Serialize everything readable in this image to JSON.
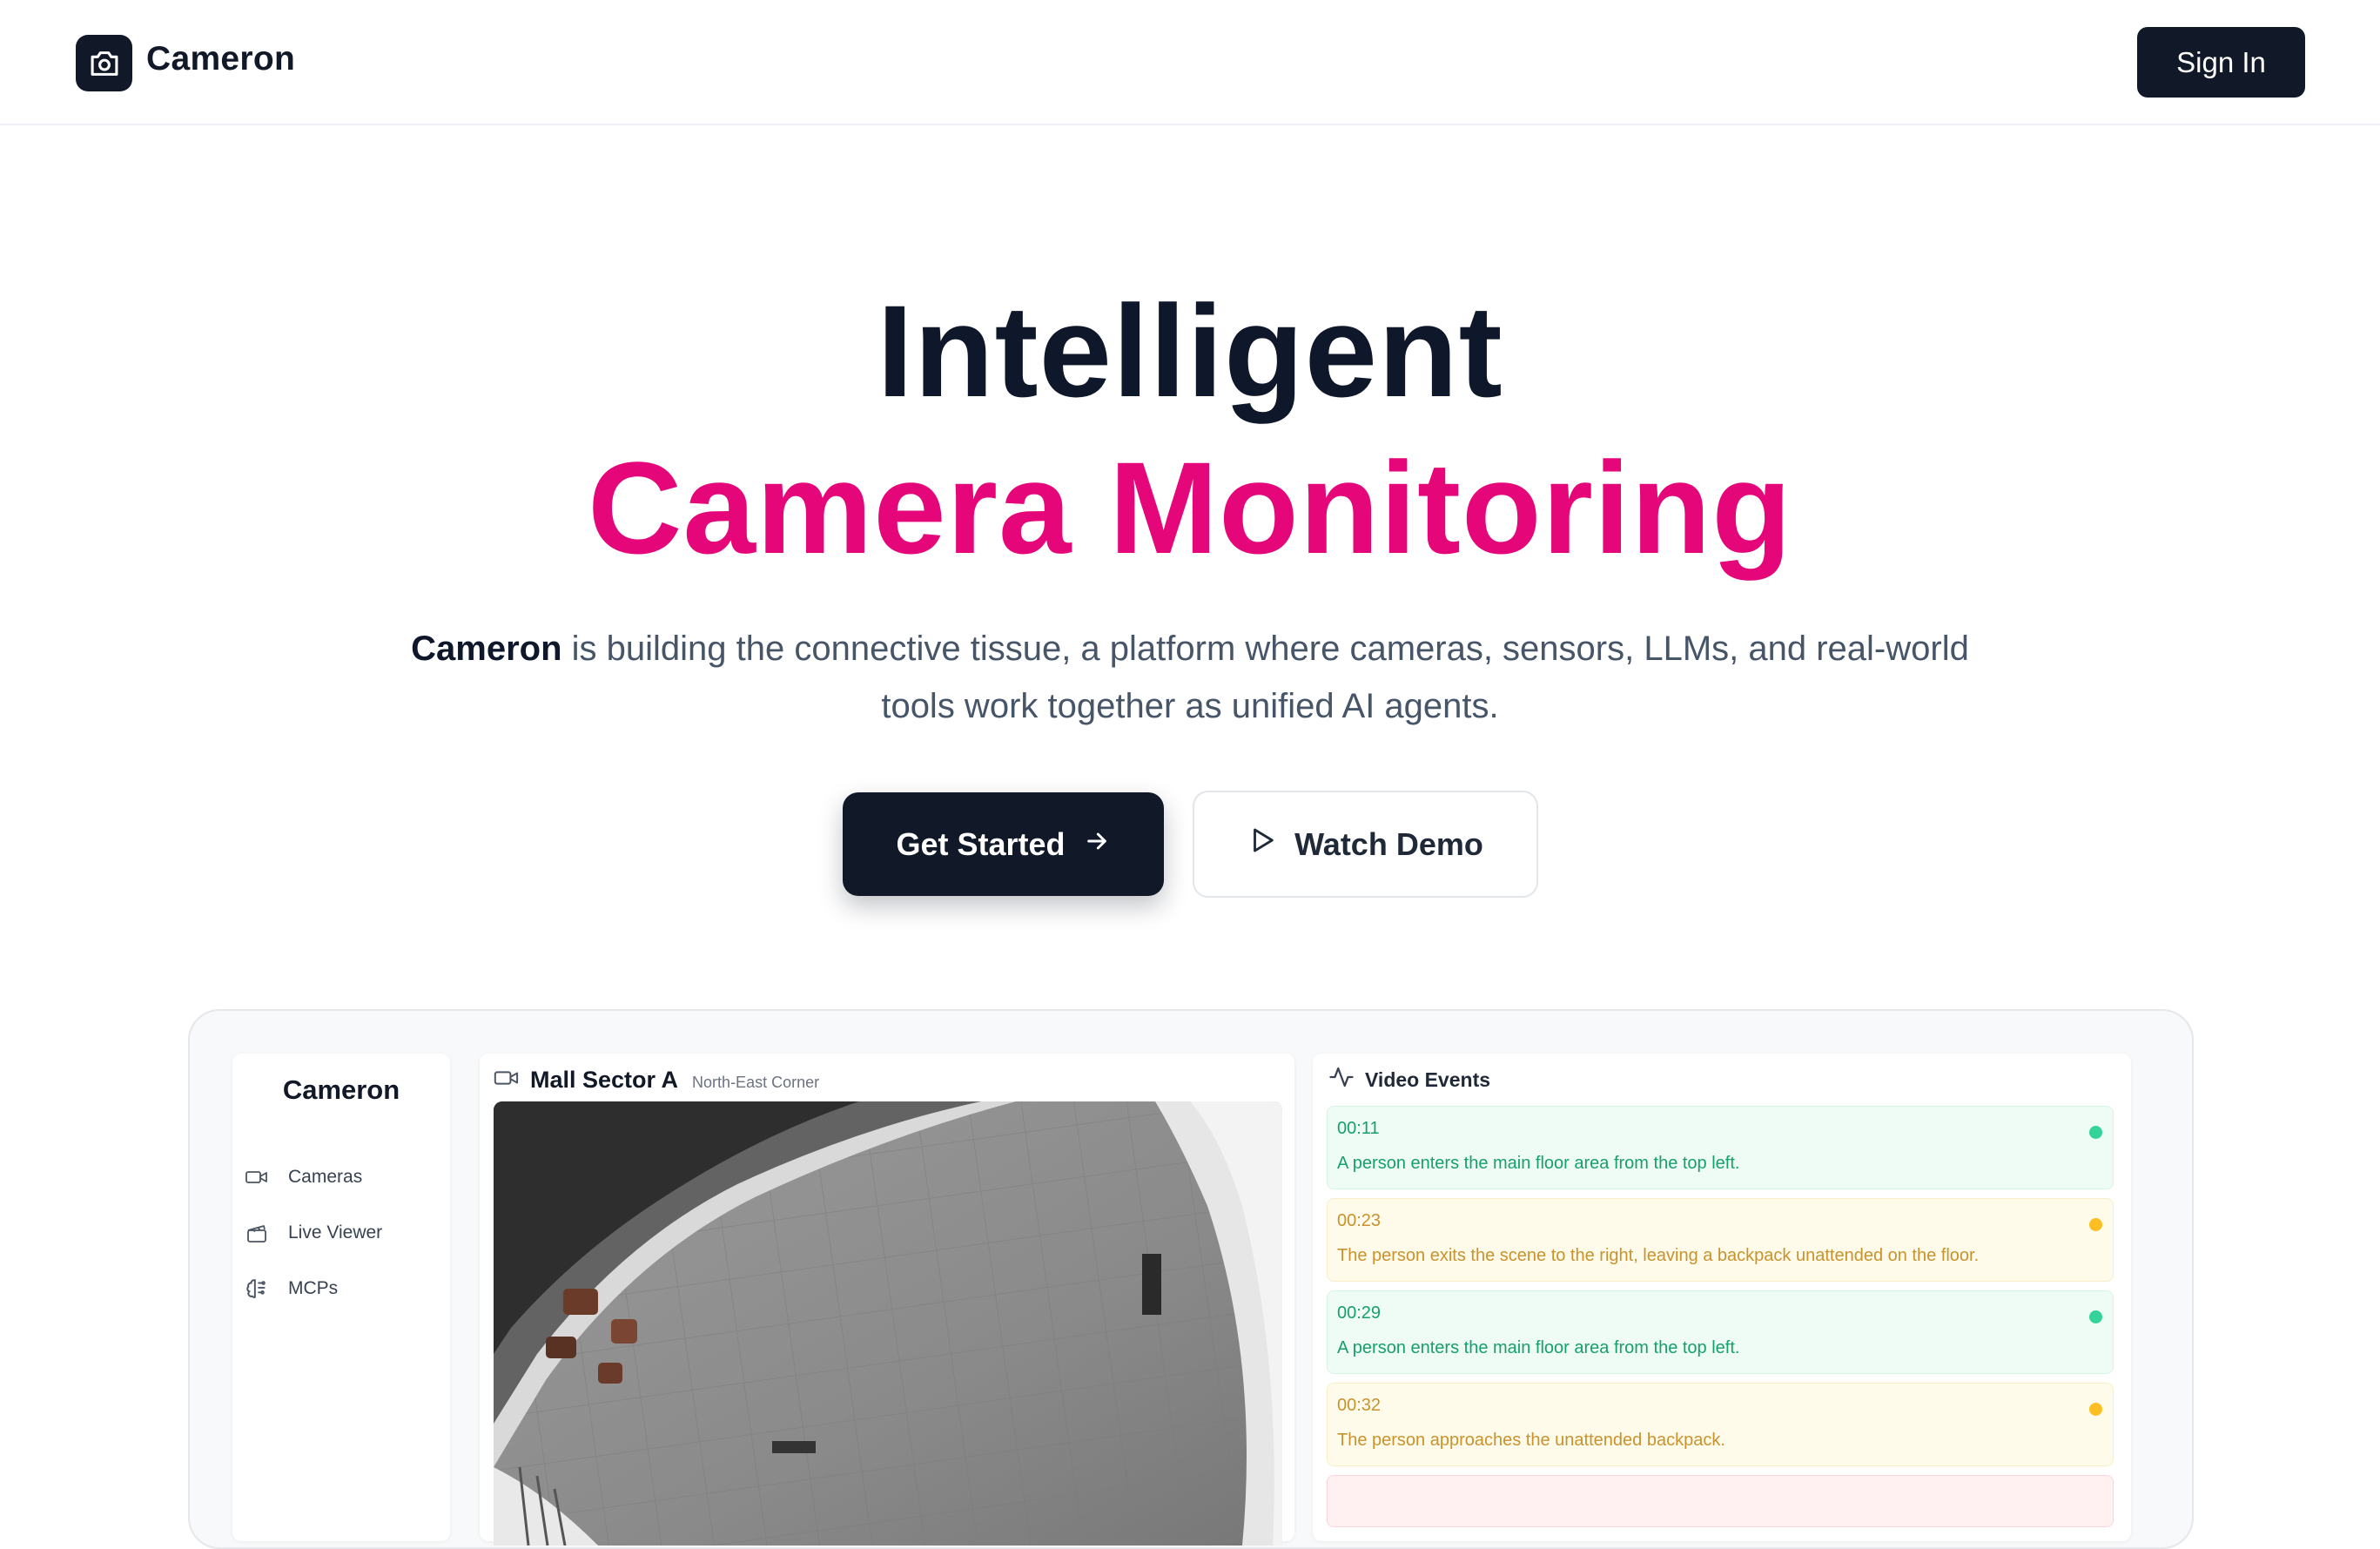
{
  "header": {
    "brand": "Cameron",
    "logo_icon": "camera-icon",
    "sign_in_label": "Sign In"
  },
  "hero": {
    "title_line1": "Intelligent",
    "title_line2": "Camera Monitoring",
    "accent_color": "#e5077a",
    "subtitle_brand": "Cameron",
    "subtitle_rest": " is building the connective tissue, a platform where cameras, sensors, LLMs, and real-world tools work together as unified AI agents.",
    "primary_cta": "Get Started",
    "primary_cta_icon": "arrow-right-icon",
    "secondary_cta": "Watch Demo",
    "secondary_cta_icon": "play-icon"
  },
  "preview": {
    "sidebar": {
      "brand": "Cameron",
      "items": [
        {
          "label": "Cameras",
          "icon": "video-camera-icon"
        },
        {
          "label": "Live Viewer",
          "icon": "clapperboard-icon"
        },
        {
          "label": "MCPs",
          "icon": "brain-icon"
        }
      ]
    },
    "camera": {
      "name": "Mall Sector A",
      "location": "North-East Corner",
      "icon": "video-camera-icon"
    },
    "events": {
      "title": "Video Events",
      "icon": "activity-icon",
      "items": [
        {
          "time": "00:11",
          "text": "A person enters the main floor area from the top left.",
          "status": "green"
        },
        {
          "time": "00:23",
          "text": "The person exits the scene to the right, leaving a backpack unattended on the floor.",
          "status": "yellow"
        },
        {
          "time": "00:29",
          "text": "A person enters the main floor area from the top left.",
          "status": "green"
        },
        {
          "time": "00:32",
          "text": "The person approaches the unattended backpack.",
          "status": "yellow"
        }
      ]
    }
  }
}
